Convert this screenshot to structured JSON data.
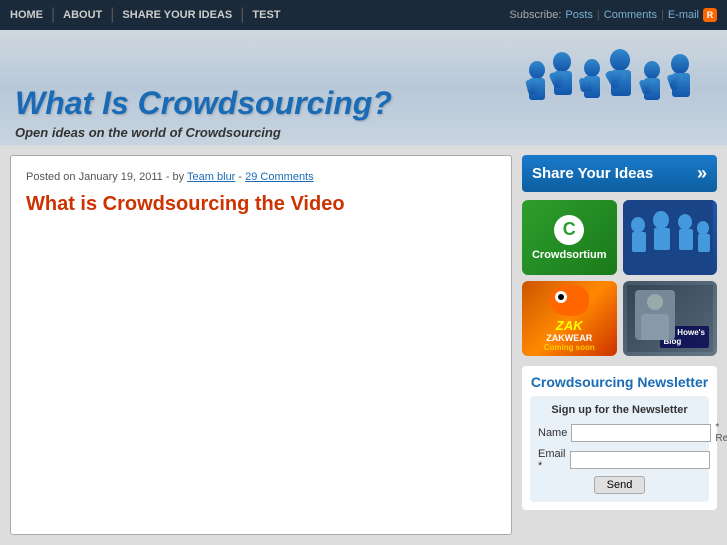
{
  "topnav": {
    "links": [
      {
        "label": "HOME",
        "href": "#"
      },
      {
        "label": "ABOUT",
        "href": "#"
      },
      {
        "label": "SHARE YOUR IDEAS",
        "href": "#"
      },
      {
        "label": "TEST",
        "href": "#"
      }
    ],
    "subscribe_label": "Subscribe:",
    "subscribe_links": [
      {
        "label": "Posts",
        "href": "#"
      },
      {
        "label": "Comments",
        "href": "#"
      },
      {
        "label": "E-mail",
        "href": "#"
      }
    ]
  },
  "header": {
    "title": "What Is Crowdsourcing?",
    "tagline": "Open ideas on the world of Crowdsourcing"
  },
  "post": {
    "meta": "Posted on January 19, 2011 - by",
    "author": "Team blur",
    "comments": "29 Comments",
    "title": "What is Crowdsourcing the Video"
  },
  "sidebar": {
    "share_label": "Share Your Ideas",
    "arrow": "»",
    "thumbs": [
      {
        "id": "crowdsortium",
        "label": "Crowdsortium"
      },
      {
        "id": "crowd2",
        "label": ""
      },
      {
        "id": "zak",
        "label": "ZAK",
        "sublabel": "ZAKWEAR",
        "coming": "Coming soon"
      },
      {
        "id": "jef",
        "label": "Jef Howe's",
        "sublabel": "Blog"
      }
    ],
    "newsletter": {
      "title": "Crowdsourcing Newsletter",
      "form_title": "Sign up for the Newsletter",
      "name_label": "Name",
      "email_label": "Email *",
      "required_text": "* Required",
      "send_label": "Send"
    }
  }
}
